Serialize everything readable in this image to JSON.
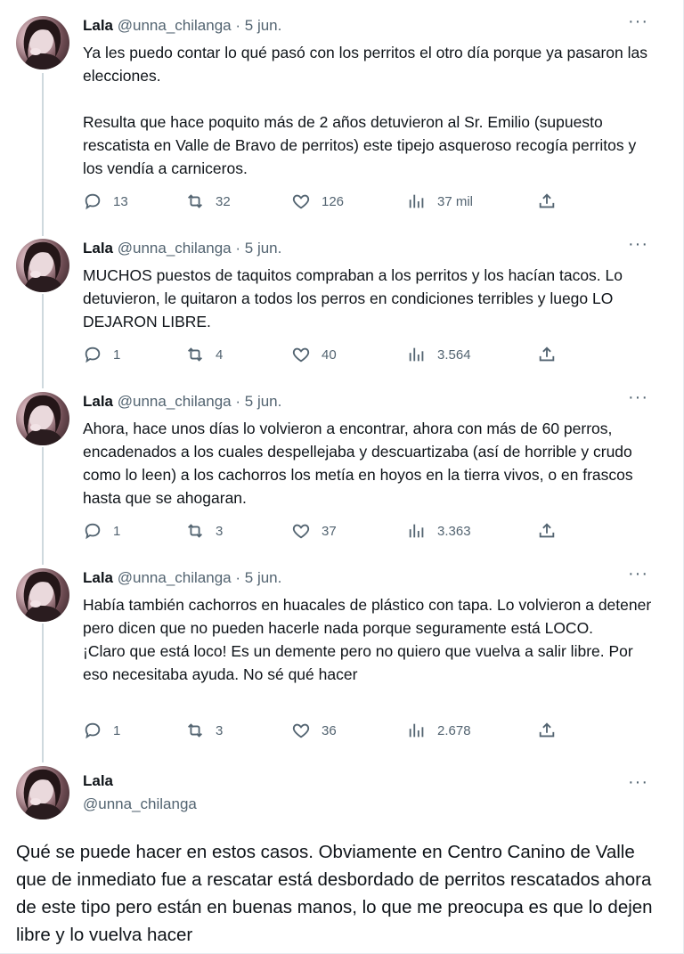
{
  "tweets": [
    {
      "name": "Lala",
      "handle": "@unna_chilanga",
      "dot": "·",
      "date": "5 jun.",
      "more": "···",
      "text": "Ya les puedo contar lo qué pasó con los perritos el otro día porque ya pasaron las elecciones.\n\nResulta que hace poquito más de 2 años detuvieron al Sr. Emilio (supuesto rescatista en Valle de Bravo de perritos) este tipejo asqueroso recogía perritos y los vendía a carniceros.",
      "replies": "13",
      "retweets": "32",
      "likes": "126",
      "views": "37 mil"
    },
    {
      "name": "Lala",
      "handle": "@unna_chilanga",
      "dot": "·",
      "date": "5 jun.",
      "more": "···",
      "text": "MUCHOS puestos de taquitos compraban a los perritos y los hacían tacos. Lo detuvieron, le quitaron a todos los perros en condiciones terribles y luego LO DEJARON LIBRE.",
      "replies": "1",
      "retweets": "4",
      "likes": "40",
      "views": "3.564"
    },
    {
      "name": "Lala",
      "handle": "@unna_chilanga",
      "dot": "·",
      "date": "5 jun.",
      "more": "···",
      "text": "Ahora, hace unos días lo volvieron a encontrar, ahora con más de 60 perros, encadenados a los cuales despellejaba y descuartizaba (así de horrible y crudo como lo leen) a los cachorros los metía en hoyos en la tierra vivos, o en frascos hasta que se ahogaran.",
      "replies": "1",
      "retweets": "3",
      "likes": "37",
      "views": "3.363"
    },
    {
      "name": "Lala",
      "handle": "@unna_chilanga",
      "dot": "·",
      "date": "5 jun.",
      "more": "···",
      "text": "Había también cachorros en huacales de plástico con tapa. Lo volvieron a detener pero dicen que no pueden hacerle nada porque seguramente está LOCO.\n¡Claro que está loco! Es un demente pero no quiero que vuelva a salir libre. Por eso necesitaba ayuda. No sé qué hacer",
      "replies": "1",
      "retweets": "3",
      "likes": "36",
      "views": "2.678"
    }
  ],
  "main_tweet": {
    "name": "Lala",
    "handle": "@unna_chilanga",
    "more": "···",
    "text": "Qué se puede hacer en estos casos. Obviamente en Centro Canino de Valle que de inmediato fue a rescatar está desbordado de perritos rescatados ahora de este tipo pero están en buenas manos, lo que me preocupa es que lo dejen libre y lo vuelva hacer"
  },
  "icons": {
    "reply": "reply-icon",
    "retweet": "retweet-icon",
    "like": "heart-icon",
    "views": "views-icon",
    "share": "share-icon"
  },
  "colors": {
    "text": "#0f1419",
    "secondary": "#536471",
    "thread_line": "#cfd9de"
  }
}
